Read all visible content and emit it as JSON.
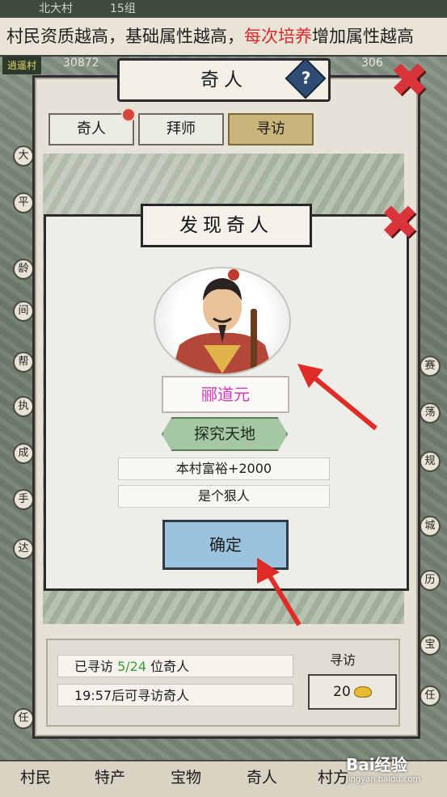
{
  "status_bar": {
    "left": "北大村",
    "mid": "15组"
  },
  "ticker": {
    "part1": "村民资质越高，基础属性越高，",
    "highlight": "每次培养",
    "part2": "增加属性越高"
  },
  "resources": {
    "village_badge": "逍遥村",
    "value1": "30872",
    "value2": "306"
  },
  "panel": {
    "title": "奇人",
    "help_label": "?",
    "tabs": [
      {
        "label": "奇人",
        "active": false
      },
      {
        "label": "拜师",
        "active": false
      },
      {
        "label": "寻访",
        "active": true
      }
    ]
  },
  "popup": {
    "title": "发现奇人",
    "person_name": "郦道元",
    "trait": "探究天地",
    "info_lines": [
      "本村富裕+2000",
      "是个狠人"
    ],
    "confirm_label": "确定"
  },
  "visit_status": {
    "visited_prefix": "已寻访 ",
    "visited_count": "5/24",
    "visited_suffix": " 位奇人",
    "cooldown": "19:57后可寻访奇人",
    "visit_label": "寻访",
    "cost": "20"
  },
  "side_icons_left": [
    "大",
    "平",
    "龄",
    "间",
    "帮",
    "执",
    "成",
    "手",
    "达",
    "任"
  ],
  "side_icons_right": [
    "赛",
    "荡",
    "规",
    "城",
    "历",
    "宝",
    "任"
  ],
  "bottom_nav": [
    "村民",
    "特产",
    "宝物",
    "奇人",
    "村方"
  ],
  "watermark": {
    "brand": "Bai经验",
    "url": "jingyan.baidu.com"
  },
  "colors": {
    "highlight_red": "#d8262b",
    "name_magenta": "#d23ab9",
    "count_green": "#3b9a3b",
    "confirm_blue": "#9cc3dd",
    "trait_green": "#a5c7a4",
    "close_red": "#d9343a"
  }
}
